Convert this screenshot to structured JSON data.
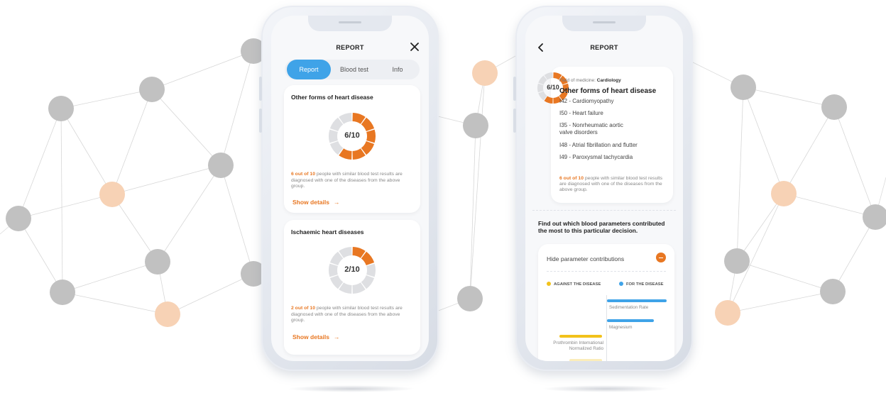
{
  "colors": {
    "accent_orange": "#e87722",
    "accent_blue": "#3fa3e8",
    "against_yellow": "#f2c21b",
    "node_gray": "#c1c1c1",
    "node_peach": "#f7d2b5"
  },
  "left_screen": {
    "header_title": "REPORT",
    "close_icon": "close-icon",
    "tabs": [
      {
        "label": "Report",
        "active": true
      },
      {
        "label": "Blood test",
        "active": false
      },
      {
        "label": "Info",
        "active": false
      }
    ],
    "cards": [
      {
        "title": "Other forms of heart disease",
        "score_label": "6/10",
        "score": 6,
        "total": 10,
        "highlight": "6 out of 10",
        "description": " people with similar blood test results are diagnosed with one of the diseases from the above group.",
        "link": "Show details",
        "link_icon": "arrow-right-icon"
      },
      {
        "title": "Ischaemic heart diseases",
        "score_label": "2/10",
        "score": 2,
        "total": 10,
        "highlight": "2 out of 10",
        "description": " people with similar blood test results are diagnosed with one of the diseases from the above group.",
        "link": "Show details",
        "link_icon": "arrow-right-icon"
      }
    ]
  },
  "right_screen": {
    "header_title": "REPORT",
    "back_icon": "chevron-left-icon",
    "score_label": "6/10",
    "score": 6,
    "total": 10,
    "field_label": "Field of medicine: ",
    "field_value": "Cardiology",
    "title": "Other forms of heart disease",
    "diseases": [
      "I42 - Cardiomyopathy",
      "I50 - Heart failure",
      "I35 - Nonrheumatic aortic valve disorders",
      "I48 - Atrial fibrillation and flutter",
      "I49 - Paroxysmal tachycardia"
    ],
    "highlight": "6 out of 10",
    "description": " people with similar blood test results are diagnosed with one of the diseases from the above group.",
    "find_out": "Find out which blood parameters contributed the most to this particular decision.",
    "toggle_label": "Hide parameter contributions",
    "toggle_icon": "minus-icon",
    "legend_against": "AGAINST THE DISEASE",
    "legend_for": "FOR THE DISEASE",
    "parameters": [
      {
        "name": "Sedimentation Rate",
        "direction": "for"
      },
      {
        "name": "Magnesium",
        "direction": "for"
      },
      {
        "name": "Prothrombin International Normalized Ratio",
        "direction": "against"
      }
    ]
  }
}
